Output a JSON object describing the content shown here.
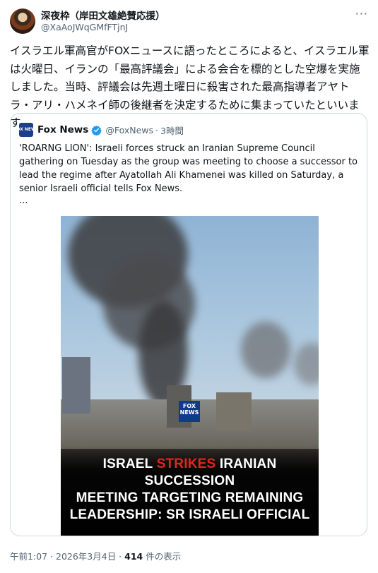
{
  "author": {
    "name": "深夜枠（岸田文雄絶賛応援）",
    "handle": "@XaAoJWqGMfFTjnJ",
    "more": "···"
  },
  "post": {
    "text": "イスラエル軍高官がFOXニュースに語ったところによると、イスラエル軍は火曜日、イランの「最高評議会」による会合を標的とした空爆を実施しました。当時、評議会は先週土曜日に殺害された最高指導者アヤトラ・アリ・ハメネイ師の後継者を決定するために集まっていたといいます。"
  },
  "quote": {
    "logo": "FOX NEWS",
    "name": "Fox News",
    "handle": "@FoxNews",
    "sep": "·",
    "time": "3時間",
    "text": "'ROARNG LION': Israeli forces struck an Iranian Supreme Council gathering on Tuesday as the group was meeting to choose a successor to lead the regime after Ayatollah Ali Khamenei was killed on Saturday, a senior Israeli official tells Fox News.",
    "ellipsis": "...",
    "image": {
      "logo": "FOX NEWS",
      "line1_a": "ISRAEL ",
      "line1_red": "STRIKES",
      "line1_b": " IRANIAN SUCCESSION",
      "line2": "MEETING TARGETING REMAINING",
      "line3": "LEADERSHIP: SR ISRAELI OFFICIAL"
    }
  },
  "footer": {
    "time": "午前1:07 · 2026年3月4日 · ",
    "views": "414",
    "views_label": " 件の表示"
  },
  "colors": {
    "verified": "#1d9bf0",
    "accent_red": "#e1261c"
  }
}
